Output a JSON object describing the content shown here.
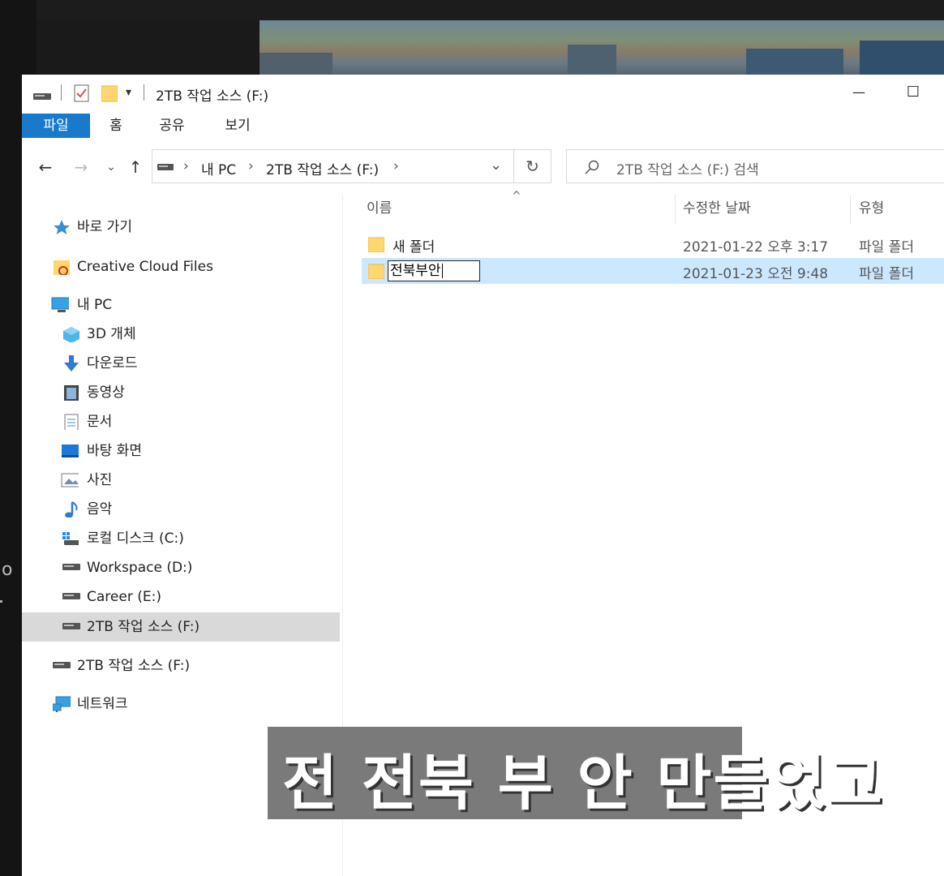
{
  "window": {
    "title": "2TB 작업 소스 (F:)",
    "minimize_glyph": "—",
    "maximize_glyph": "☐"
  },
  "ribbon": {
    "tabs": [
      "파일",
      "홈",
      "공유",
      "보기"
    ]
  },
  "nav": {
    "back_glyph": "←",
    "forward_glyph": "→",
    "recent_glyph": "⌄",
    "up_glyph": "↑",
    "breadcrumb": [
      "내 PC",
      "2TB 작업 소스 (F:)"
    ],
    "refresh_glyph": "↻",
    "search_placeholder": "2TB 작업 소스 (F:) 검색"
  },
  "sidebar": {
    "items": [
      {
        "label": "바로 가기",
        "icon": "star-icon"
      },
      {
        "label": "Creative Cloud Files",
        "icon": "creative-cloud-folder-icon"
      },
      {
        "label": "내 PC",
        "icon": "pc-icon"
      },
      {
        "label": "3D 개체",
        "icon": "3d-objects-icon"
      },
      {
        "label": "다운로드",
        "icon": "download-icon"
      },
      {
        "label": "동영상",
        "icon": "video-icon"
      },
      {
        "label": "문서",
        "icon": "document-icon"
      },
      {
        "label": "바탕 화면",
        "icon": "desktop-icon"
      },
      {
        "label": "사진",
        "icon": "picture-icon"
      },
      {
        "label": "음악",
        "icon": "music-icon"
      },
      {
        "label": "로컬 디스크 (C:)",
        "icon": "windows-drive-icon"
      },
      {
        "label": "Workspace (D:)",
        "icon": "drive-icon"
      },
      {
        "label": "Career (E:)",
        "icon": "drive-icon"
      },
      {
        "label": "2TB 작업 소스 (F:)",
        "icon": "drive-icon"
      },
      {
        "label": "2TB 작업 소스 (F:)",
        "icon": "drive-icon"
      },
      {
        "label": "네트워크",
        "icon": "network-icon"
      }
    ]
  },
  "list": {
    "sort_glyph": "^",
    "columns": [
      "이름",
      "수정한 날짜",
      "유형"
    ],
    "rows": [
      {
        "name": "새 폴더",
        "modified": "2021-01-22 오후 3:17",
        "type": "파일 폴더"
      },
      {
        "name": "전북부안",
        "modified": "2021-01-23 오전 9:48",
        "type": "파일 폴더"
      }
    ]
  },
  "overlay": {
    "left_edge_text": "o",
    "caption": "전 전북 부 안 만들었고"
  },
  "colors": {
    "accent": "#1979ca",
    "selection": "#cce8ff",
    "nav_selection": "#d9d9d9",
    "folder": "#ffd76e"
  }
}
